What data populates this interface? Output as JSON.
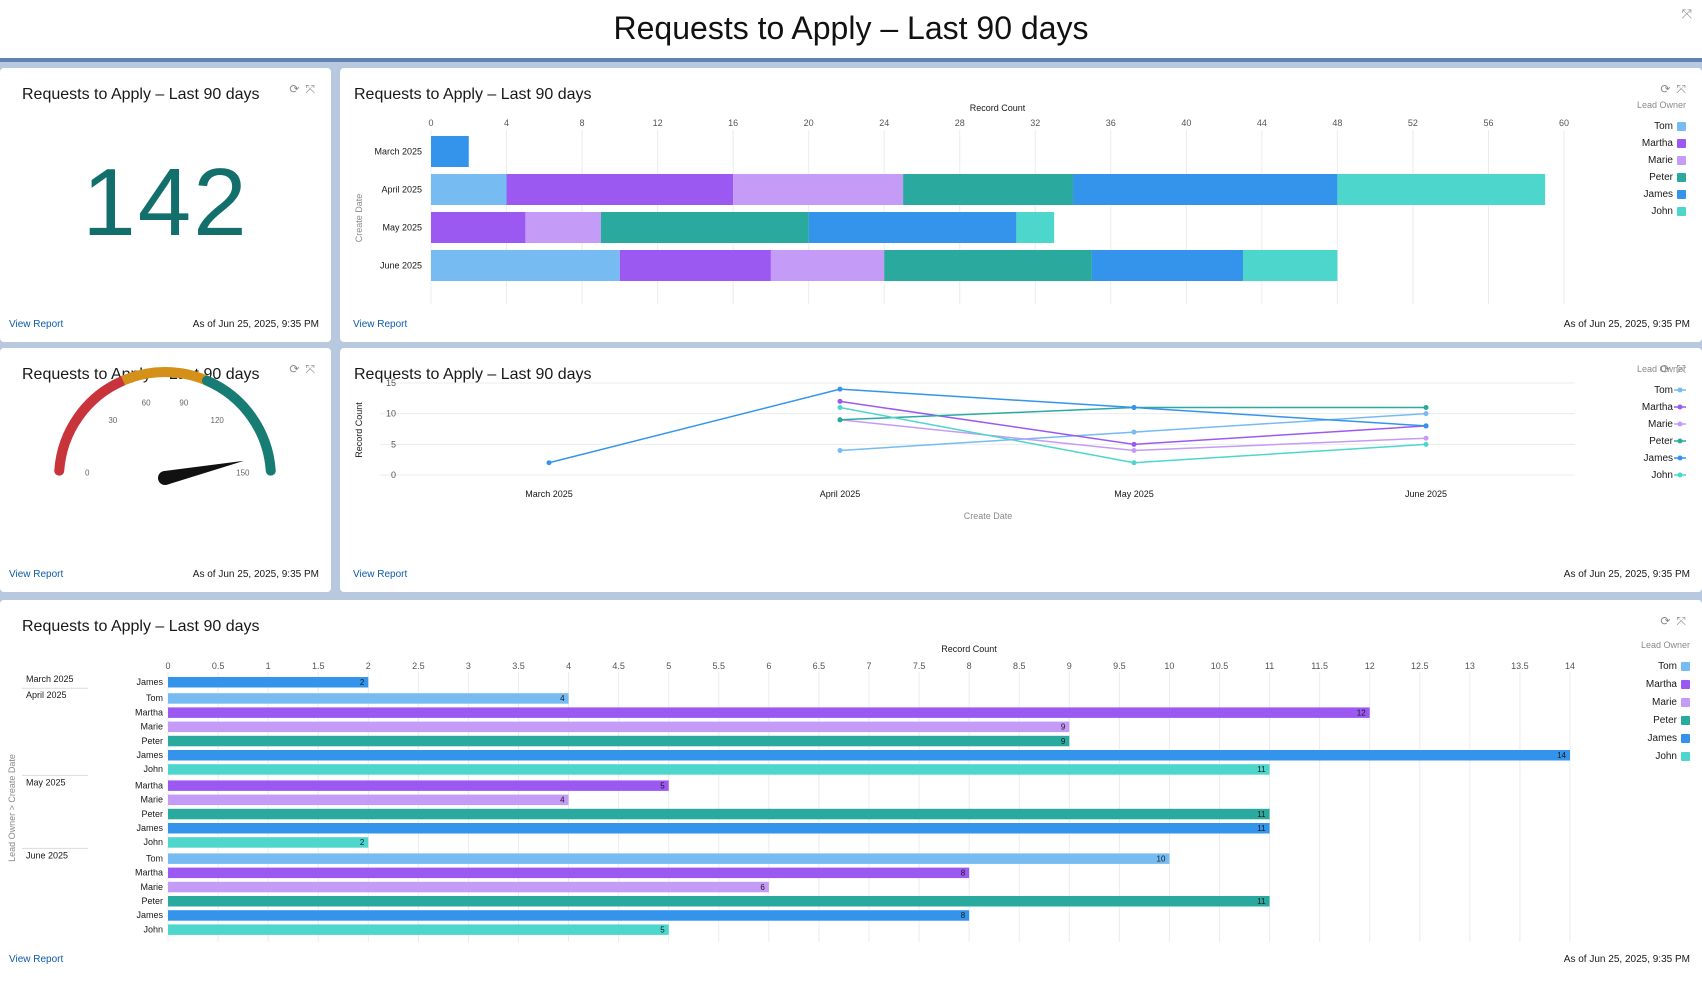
{
  "header": {
    "title": "Requests to Apply – Last 90 days"
  },
  "common": {
    "view_report": "View Report",
    "as_of": "As of Jun 25, 2025, 9:35 PM"
  },
  "metric": {
    "title": "Requests to Apply – Last 90 days",
    "value": "142"
  },
  "stacked": {
    "title": "Requests to Apply – Last 90 days"
  },
  "gauge": {
    "title": "Requests to Apply – Last 90 days"
  },
  "line": {
    "title": "Requests to Apply – Last 90 days"
  },
  "grouped": {
    "title": "Requests to Apply – Last 90 days"
  },
  "colors": {
    "Tom": "#76bbf2",
    "Martha": "#9b59f2",
    "Marie": "#c49bf6",
    "Peter": "#2aaa9e",
    "James": "#3494ec",
    "John": "#4dd6cc",
    "metric": "#126f6c",
    "link": "#0b5cad"
  },
  "chart_data": [
    {
      "type": "bar",
      "orientation": "horizontal-stacked",
      "categories": [
        "March 2025",
        "April 2025",
        "May 2025",
        "June 2025"
      ],
      "series": [
        {
          "name": "Tom",
          "values": [
            0,
            4,
            0,
            10
          ]
        },
        {
          "name": "Martha",
          "values": [
            0,
            12,
            5,
            8
          ]
        },
        {
          "name": "Marie",
          "values": [
            0,
            9,
            4,
            6
          ]
        },
        {
          "name": "Peter",
          "values": [
            0,
            9,
            11,
            11
          ]
        },
        {
          "name": "James",
          "values": [
            2,
            14,
            11,
            8
          ]
        },
        {
          "name": "John",
          "values": [
            0,
            11,
            2,
            5
          ]
        }
      ],
      "xlabel": "Record Count",
      "ylabel": "Create Date",
      "xlim": [
        0,
        60
      ],
      "xticks": [
        0,
        4,
        8,
        12,
        16,
        20,
        24,
        28,
        32,
        36,
        40,
        44,
        48,
        52,
        56,
        60
      ],
      "legend_title": "Lead Owner",
      "legend_placement": "right"
    },
    {
      "type": "gauge",
      "value": 142,
      "min": 0,
      "max": 150,
      "ticks": [
        0,
        30,
        60,
        90,
        120,
        150
      ],
      "bands": [
        {
          "from": 0,
          "to": 50,
          "color": "#c9343a"
        },
        {
          "from": 50,
          "to": 100,
          "color": "#d59019"
        },
        {
          "from": 100,
          "to": 150,
          "color": "#177c74"
        }
      ]
    },
    {
      "type": "line",
      "categories": [
        "March 2025",
        "April 2025",
        "May 2025",
        "June 2025"
      ],
      "series": [
        {
          "name": "Tom",
          "values": [
            null,
            4,
            7,
            10
          ]
        },
        {
          "name": "Martha",
          "values": [
            null,
            12,
            5,
            8
          ]
        },
        {
          "name": "Marie",
          "values": [
            null,
            9,
            4,
            6
          ]
        },
        {
          "name": "Peter",
          "values": [
            null,
            9,
            11,
            11
          ]
        },
        {
          "name": "James",
          "values": [
            2,
            14,
            11,
            8
          ]
        },
        {
          "name": "John",
          "values": [
            null,
            11,
            2,
            5
          ]
        }
      ],
      "xlabel": "Create Date",
      "ylabel": "Record Count",
      "ylim": [
        0,
        15
      ],
      "yticks": [
        0,
        5,
        10,
        15
      ],
      "legend_title": "Lead Owner",
      "legend_placement": "right"
    },
    {
      "type": "bar",
      "orientation": "horizontal-grouped",
      "groups": [
        {
          "label": "March 2025",
          "rows": [
            {
              "name": "James",
              "value": 2
            }
          ]
        },
        {
          "label": "April 2025",
          "rows": [
            {
              "name": "Tom",
              "value": 4
            },
            {
              "name": "Martha",
              "value": 12
            },
            {
              "name": "Marie",
              "value": 9
            },
            {
              "name": "Peter",
              "value": 9
            },
            {
              "name": "James",
              "value": 14
            },
            {
              "name": "John",
              "value": 11
            }
          ]
        },
        {
          "label": "May 2025",
          "rows": [
            {
              "name": "Martha",
              "value": 5
            },
            {
              "name": "Marie",
              "value": 4
            },
            {
              "name": "Peter",
              "value": 11
            },
            {
              "name": "James",
              "value": 11
            },
            {
              "name": "John",
              "value": 2
            }
          ]
        },
        {
          "label": "June 2025",
          "rows": [
            {
              "name": "Tom",
              "value": 10
            },
            {
              "name": "Martha",
              "value": 8
            },
            {
              "name": "Marie",
              "value": 6
            },
            {
              "name": "Peter",
              "value": 11
            },
            {
              "name": "James",
              "value": 8
            },
            {
              "name": "John",
              "value": 5
            }
          ]
        }
      ],
      "xlabel": "Record Count",
      "ylabel": "Lead Owner > Create Date",
      "xlim": [
        0,
        14
      ],
      "xticks": [
        "0",
        "0.5",
        "1",
        "1.5",
        "2",
        "2.5",
        "3",
        "3.5",
        "4",
        "4.5",
        "5",
        "5.5",
        "6",
        "6.5",
        "7",
        "7.5",
        "8",
        "8.5",
        "9",
        "9.5",
        "10",
        "10.5",
        "11",
        "11.5",
        "12",
        "12.5",
        "13",
        "13.5",
        "14"
      ],
      "legend_title": "Lead Owner",
      "legend_placement": "right"
    }
  ],
  "legend": [
    "Tom",
    "Martha",
    "Marie",
    "Peter",
    "James",
    "John"
  ]
}
